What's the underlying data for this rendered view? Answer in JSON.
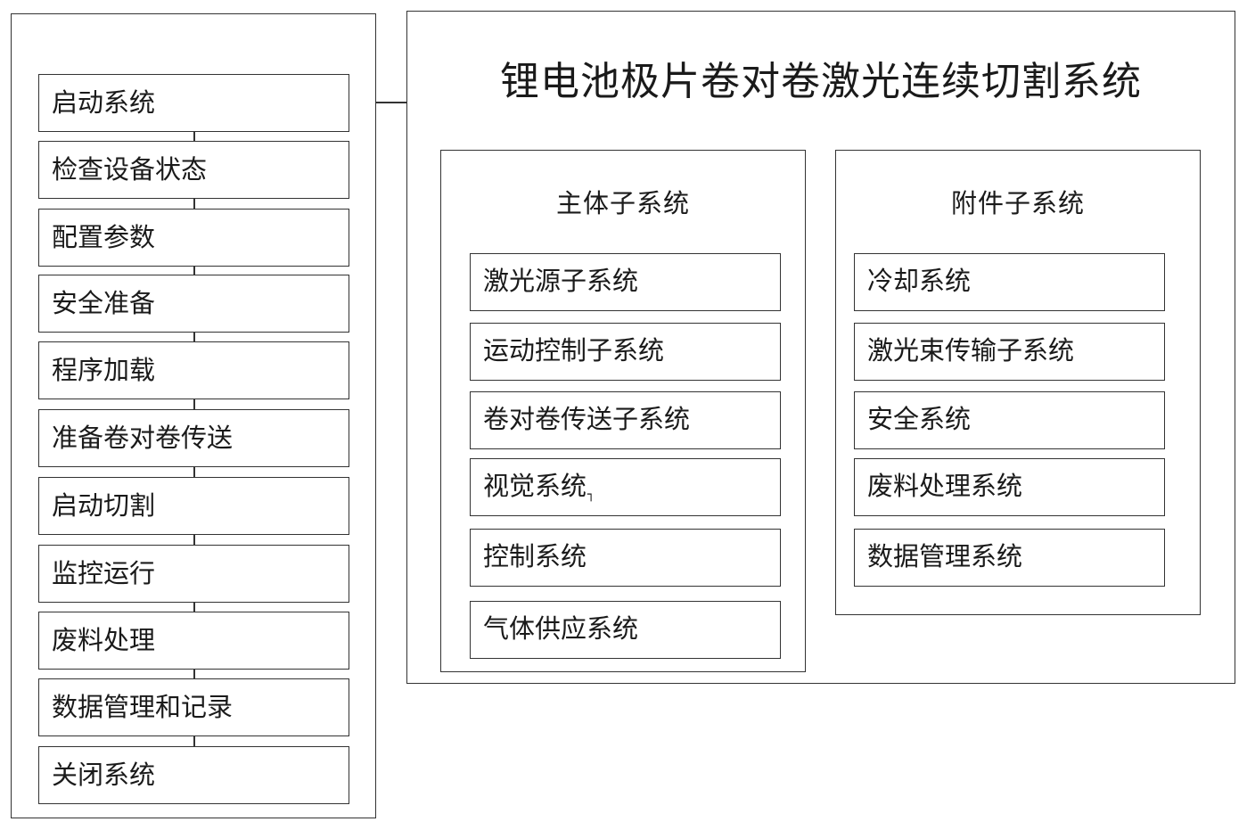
{
  "workflow": {
    "steps": [
      "启动系统",
      "检查设备状态",
      "配置参数",
      "安全准备",
      "程序加载",
      "准备卷对卷传送",
      "启动切割",
      "监控运行",
      "废料处理",
      "数据管理和记录",
      "关闭系统"
    ]
  },
  "system": {
    "title": "锂电池极片卷对卷激光连续切割系统",
    "main_subsystem": {
      "title": "主体子系统",
      "items": [
        "激光源子系统",
        "运动控制子系统",
        "卷对卷传送子系统",
        "视觉系统",
        "控制系统",
        "气体供应系统"
      ],
      "stray_mark": "┐"
    },
    "accessory_subsystem": {
      "title": "附件子系统",
      "items": [
        "冷却系统",
        "激光束传输子系统",
        "安全系统",
        "废料处理系统",
        "数据管理系统"
      ]
    }
  }
}
